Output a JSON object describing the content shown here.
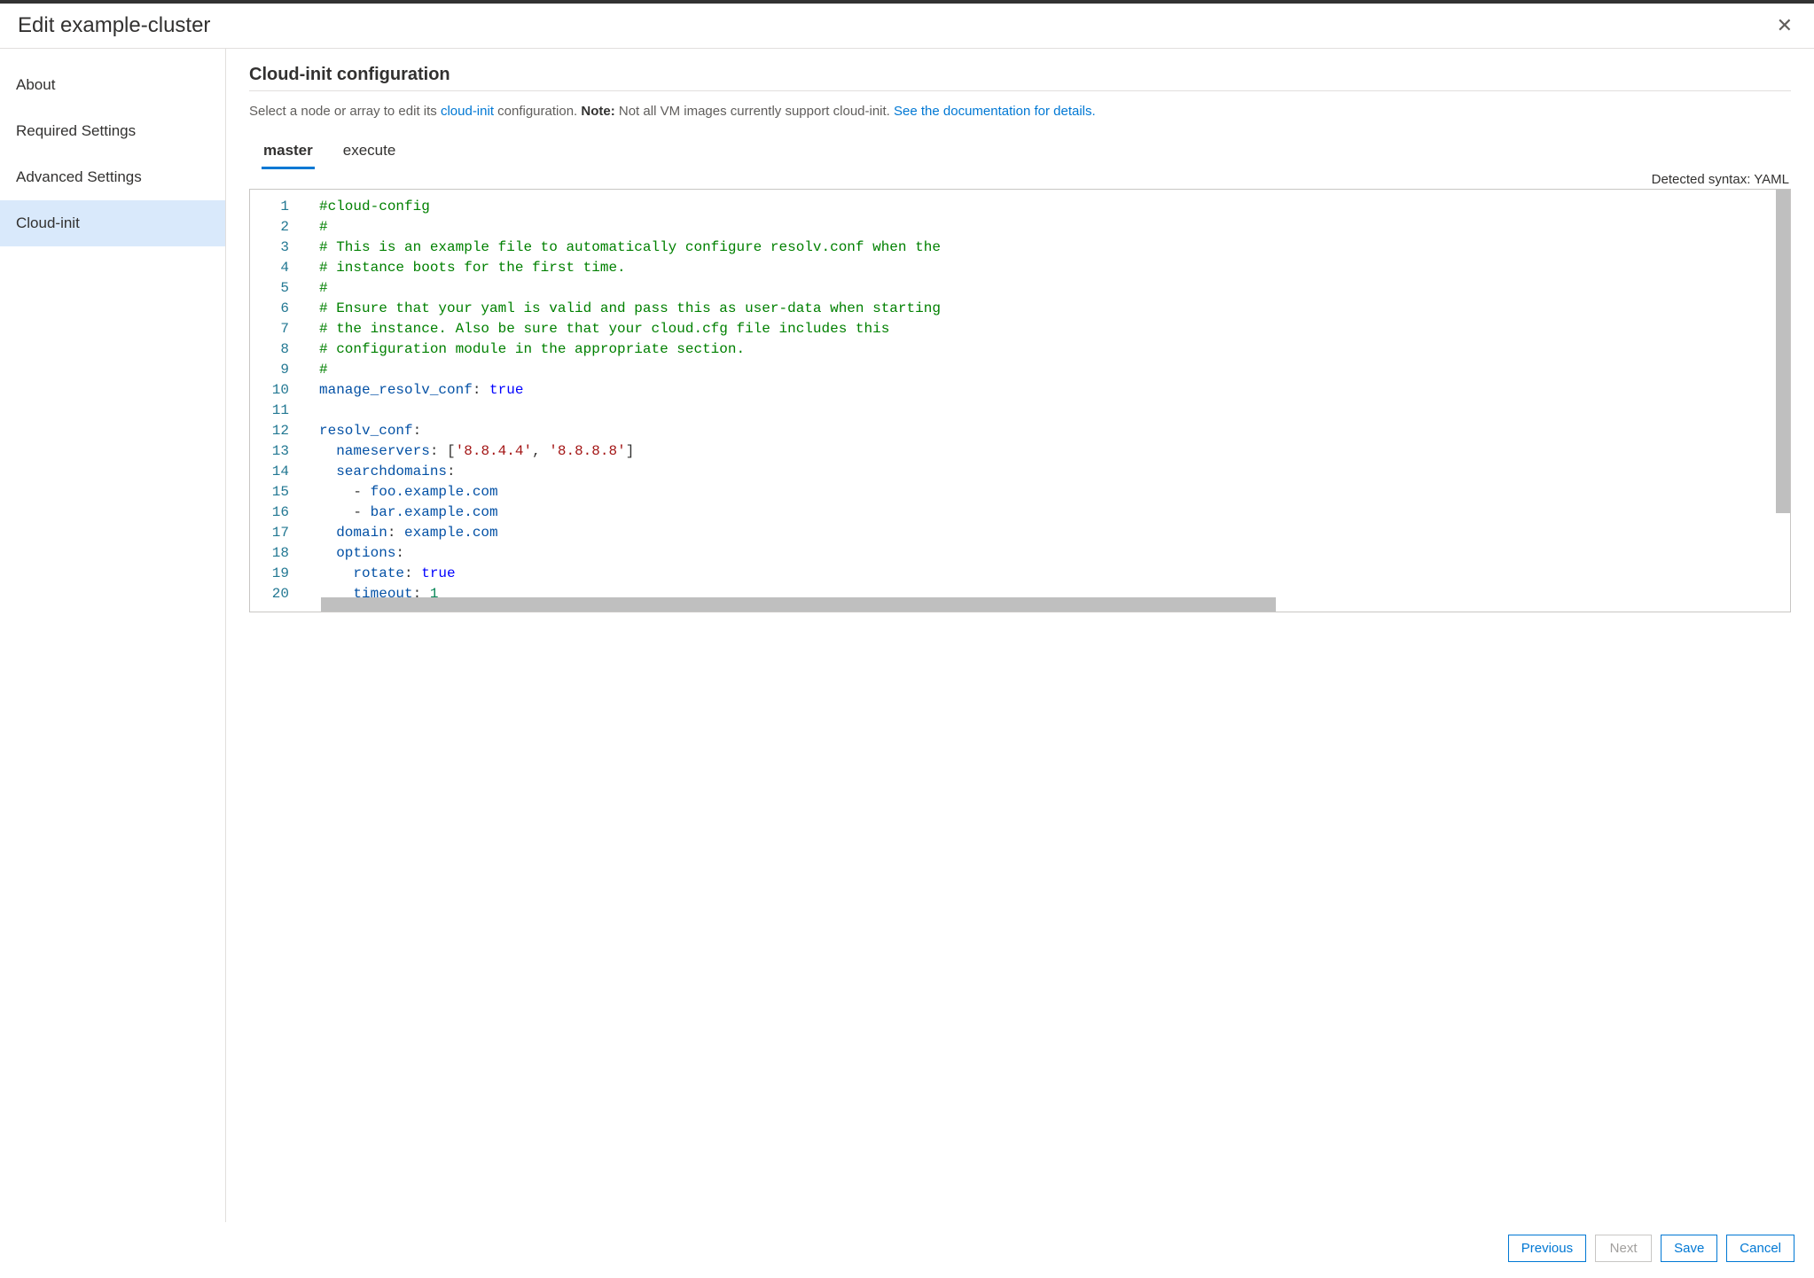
{
  "header": {
    "title": "Edit example-cluster"
  },
  "sidebar": {
    "items": [
      {
        "label": "About",
        "selected": false
      },
      {
        "label": "Required Settings",
        "selected": false
      },
      {
        "label": "Advanced Settings",
        "selected": false
      },
      {
        "label": "Cloud-init",
        "selected": true
      }
    ]
  },
  "main": {
    "section_title": "Cloud-init configuration",
    "sub_pre": "Select a node or array to edit its ",
    "sub_link1": "cloud-init",
    "sub_mid": " configuration. ",
    "sub_note_label": "Note:",
    "sub_note_text": " Not all VM images currently support cloud-init. ",
    "sub_link2": "See the documentation for details.",
    "tabs": [
      {
        "label": "master",
        "active": true
      },
      {
        "label": "execute",
        "active": false
      }
    ],
    "syntax_label": "Detected syntax: YAML",
    "code_lines": [
      {
        "n": 1,
        "tokens": [
          {
            "t": "#cloud-config",
            "c": "comment"
          }
        ]
      },
      {
        "n": 2,
        "tokens": [
          {
            "t": "#",
            "c": "comment"
          }
        ]
      },
      {
        "n": 3,
        "tokens": [
          {
            "t": "# This is an example file to automatically configure resolv.conf when the",
            "c": "comment"
          }
        ]
      },
      {
        "n": 4,
        "tokens": [
          {
            "t": "# instance boots for the first time.",
            "c": "comment"
          }
        ]
      },
      {
        "n": 5,
        "tokens": [
          {
            "t": "#",
            "c": "comment"
          }
        ]
      },
      {
        "n": 6,
        "tokens": [
          {
            "t": "# Ensure that your yaml is valid and pass this as user-data when starting",
            "c": "comment"
          }
        ]
      },
      {
        "n": 7,
        "tokens": [
          {
            "t": "# the instance. Also be sure that your cloud.cfg file includes this",
            "c": "comment"
          }
        ]
      },
      {
        "n": 8,
        "tokens": [
          {
            "t": "# configuration module in the appropriate section.",
            "c": "comment"
          }
        ]
      },
      {
        "n": 9,
        "tokens": [
          {
            "t": "#",
            "c": "comment"
          }
        ]
      },
      {
        "n": 10,
        "tokens": [
          {
            "t": "manage_resolv_conf",
            "c": "key"
          },
          {
            "t": ": ",
            "c": "punct"
          },
          {
            "t": "true",
            "c": "bool"
          }
        ]
      },
      {
        "n": 11,
        "tokens": [
          {
            "t": "",
            "c": "plain"
          }
        ]
      },
      {
        "n": 12,
        "tokens": [
          {
            "t": "resolv_conf",
            "c": "key"
          },
          {
            "t": ":",
            "c": "punct"
          }
        ]
      },
      {
        "n": 13,
        "tokens": [
          {
            "t": "  ",
            "c": "punct"
          },
          {
            "t": "nameservers",
            "c": "key"
          },
          {
            "t": ": [",
            "c": "punct"
          },
          {
            "t": "'8.8.4.4'",
            "c": "str"
          },
          {
            "t": ", ",
            "c": "punct"
          },
          {
            "t": "'8.8.8.8'",
            "c": "str"
          },
          {
            "t": "]",
            "c": "punct"
          }
        ]
      },
      {
        "n": 14,
        "tokens": [
          {
            "t": "  ",
            "c": "punct"
          },
          {
            "t": "searchdomains",
            "c": "key"
          },
          {
            "t": ":",
            "c": "punct"
          }
        ]
      },
      {
        "n": 15,
        "tokens": [
          {
            "t": "    - ",
            "c": "punct"
          },
          {
            "t": "foo.example.com",
            "c": "plain"
          }
        ]
      },
      {
        "n": 16,
        "tokens": [
          {
            "t": "    - ",
            "c": "punct"
          },
          {
            "t": "bar.example.com",
            "c": "plain"
          }
        ]
      },
      {
        "n": 17,
        "tokens": [
          {
            "t": "  ",
            "c": "punct"
          },
          {
            "t": "domain",
            "c": "key"
          },
          {
            "t": ": ",
            "c": "punct"
          },
          {
            "t": "example.com",
            "c": "plain"
          }
        ]
      },
      {
        "n": 18,
        "tokens": [
          {
            "t": "  ",
            "c": "punct"
          },
          {
            "t": "options",
            "c": "key"
          },
          {
            "t": ":",
            "c": "punct"
          }
        ]
      },
      {
        "n": 19,
        "tokens": [
          {
            "t": "    ",
            "c": "punct"
          },
          {
            "t": "rotate",
            "c": "key"
          },
          {
            "t": ": ",
            "c": "punct"
          },
          {
            "t": "true",
            "c": "bool"
          }
        ]
      },
      {
        "n": 20,
        "tokens": [
          {
            "t": "    ",
            "c": "punct"
          },
          {
            "t": "timeout",
            "c": "key"
          },
          {
            "t": ": ",
            "c": "punct"
          },
          {
            "t": "1",
            "c": "num"
          }
        ]
      }
    ]
  },
  "footer": {
    "previous": "Previous",
    "next": "Next",
    "save": "Save",
    "cancel": "Cancel"
  }
}
